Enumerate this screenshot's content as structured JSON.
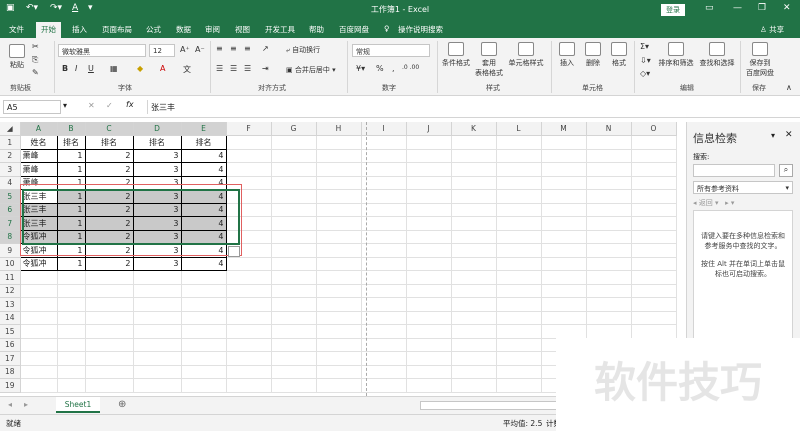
{
  "titlebar": {
    "title": "工作簿1 - Excel",
    "login": "登录"
  },
  "tabs": [
    "文件",
    "开始",
    "插入",
    "页面布局",
    "公式",
    "数据",
    "审阅",
    "视图",
    "开发工具",
    "帮助",
    "百度网盘",
    "操作说明搜索"
  ],
  "share": "共享",
  "ribbon": {
    "paste": "粘贴",
    "clipboard": "剪贴板",
    "font_name": "微软雅黑",
    "font_size": "12",
    "font_group": "字体",
    "wrap": "自动换行",
    "merge": "合并后居中",
    "align_group": "对齐方式",
    "num_format": "常规",
    "num_group": "数字",
    "cond": "条件格式",
    "table_fmt": "套用\n表格格式",
    "cell_style": "单元格样式",
    "style_group": "样式",
    "insert": "插入",
    "delete": "删除",
    "format": "格式",
    "cells_group": "单元格",
    "sort": "排序和筛选",
    "find": "查找和选择",
    "edit_group": "编辑",
    "save_baidu": "保存到\n百度网盘",
    "save_group": "保存"
  },
  "namebox": "A5",
  "formula": "张三丰",
  "columns": [
    "A",
    "B",
    "C",
    "D",
    "E",
    "F",
    "G",
    "H",
    "I",
    "J",
    "K",
    "L",
    "M",
    "N",
    "O"
  ],
  "rows": [
    [
      "姓名",
      "排名",
      "排名",
      "排名",
      "排名"
    ],
    [
      "萧峰",
      "1",
      "2",
      "3",
      "4"
    ],
    [
      "萧峰",
      "1",
      "2",
      "3",
      "4"
    ],
    [
      "萧峰",
      "1",
      "2",
      "3",
      "4"
    ],
    [
      "张三丰",
      "1",
      "2",
      "3",
      "4"
    ],
    [
      "张三丰",
      "1",
      "2",
      "3",
      "4"
    ],
    [
      "张三丰",
      "1",
      "2",
      "3",
      "4"
    ],
    [
      "令狐冲",
      "1",
      "2",
      "3",
      "4"
    ],
    [
      "令狐冲",
      "1",
      "2",
      "3",
      "4"
    ],
    [
      "令狐冲",
      "1",
      "2",
      "3",
      "4"
    ]
  ],
  "row_numbers": [
    "1",
    "2",
    "3",
    "4",
    "5",
    "6",
    "7",
    "8",
    "9",
    "10",
    "11",
    "12",
    "13",
    "14",
    "15",
    "16",
    "17",
    "18",
    "19"
  ],
  "pane": {
    "title": "信息检索",
    "search_label": "搜索:",
    "source": "所有参考资料",
    "back": "返回",
    "msg1": "请键入要在多种信息检索和参考服务中查找的文字。",
    "msg2": "按住 Alt 并在单词上单击鼠标也可启动搜索。"
  },
  "sheet_tab": "Sheet1",
  "status": {
    "ready": "就绪",
    "avg": "平均值: 2.5",
    "count": "计数"
  },
  "watermark": "软件技巧"
}
